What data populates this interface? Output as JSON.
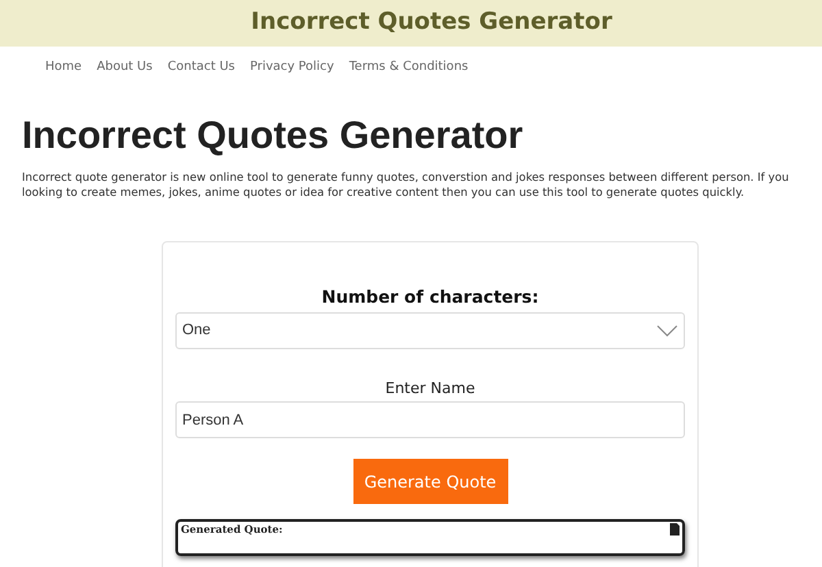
{
  "site_title": "Incorrect Quotes Generator",
  "nav": [
    {
      "label": "Home"
    },
    {
      "label": "About Us"
    },
    {
      "label": "Contact Us"
    },
    {
      "label": "Privacy Policy"
    },
    {
      "label": "Terms & Conditions"
    }
  ],
  "heading": "Incorrect Quotes Generator",
  "intro": "Incorrect quote generator is new online tool to generate funny quotes, converstion and jokes responses between different person. If you looking to create memes, jokes, anime quotes or idea for creative content then you can use this tool to generate quotes quickly.",
  "form": {
    "characters_label": "Number of characters:",
    "characters_value": "One",
    "name_label": "Enter Name",
    "name_value": "Person A",
    "button": "Generate Quote",
    "output_label": "Generated Quote:"
  }
}
